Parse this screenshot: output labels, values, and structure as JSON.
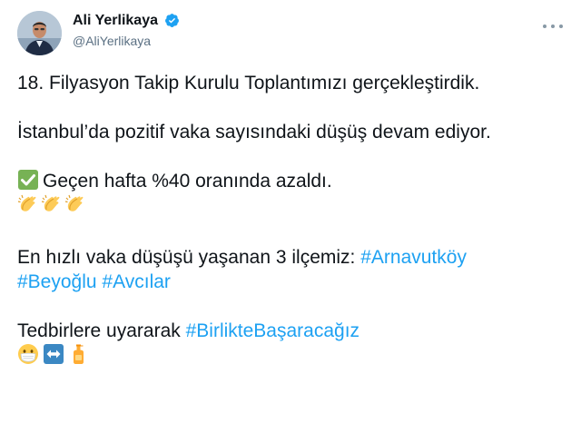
{
  "author": {
    "display_name": "Ali Yerlikaya",
    "handle": "@AliYerlikaya",
    "verified": true
  },
  "icons": {
    "verified": "verified-badge-icon",
    "more": "more-options-icon",
    "check": "white-check-mark-emoji",
    "clap": "clapping-hands-emoji",
    "mask": "face-with-medical-mask-emoji",
    "arrows": "left-right-arrow-emoji",
    "sanitizer": "lotion-bottle-emoji"
  },
  "colors": {
    "hashtag": "#1da1f2",
    "text": "#0f1419",
    "handle": "#5b7083",
    "verified": "#1da1f2",
    "check": "#77b255"
  },
  "tweet": {
    "line1": "18. Filyasyon Takip Kurulu Toplantımızı gerçekleştirdik.",
    "line2": "İstanbul’da pozitif vaka sayısındaki düşüş devam ediyor.",
    "line3": "Geçen hafta %40 oranında azaldı.",
    "line4_text": "En hızlı vaka düşüşü yaşanan 3 ilçemiz:",
    "hashtags_line4": [
      "#Arnavutköy",
      "#Beyoğlu",
      "#Avcılar"
    ],
    "line5_text": "Tedbirlere uyararak",
    "hashtag_line5": "#BirlikteBaşaracağız"
  }
}
